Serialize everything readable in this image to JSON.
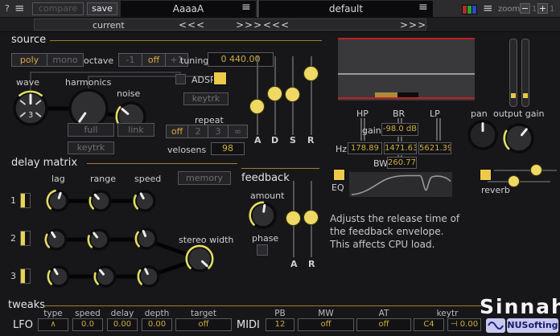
{
  "icons": {
    "menu": "≡"
  },
  "topbar": {
    "help": "?",
    "compare": "compare",
    "save": "save",
    "preset_current": "AaaaA",
    "preset_default": "default",
    "zoom_label": "zoom",
    "zoom_out": "−",
    "zoom_in": "+",
    "zoom_step": "1"
  },
  "nav": {
    "current": "current",
    "prev": "<<<",
    "next": ">>>"
  },
  "source": {
    "title": "source",
    "poly": "poly",
    "mono": "mono",
    "octave": "octave",
    "oct_down": "-1",
    "oct_off": "off",
    "oct_up": "+1",
    "tuning": "tuning",
    "tuning_value": "0 440.00",
    "wave": "wave",
    "wave_value": "3",
    "harmonics": "harmonics",
    "noise": "noise",
    "adsr": "ADSR",
    "keytrk": "keytrk",
    "full": "full",
    "link": "link",
    "repeat": "repeat",
    "repeat_off": "off",
    "repeat_2": "2",
    "repeat_3": "3",
    "repeat_inf": "∞",
    "velosens": "velosens",
    "velosens_value": "98",
    "env_a": "A",
    "env_d": "D",
    "env_s": "S",
    "env_r": "R"
  },
  "filter": {
    "hp": "HP",
    "br": "BR",
    "lp": "LP",
    "gain": "gain",
    "gain_value": "-98.0 dB",
    "hz": "Hz",
    "hp_freq": "178.89",
    "br_freq": "1471.63",
    "lp_freq": "5621.39",
    "bw": "BW",
    "bw_value": "260.77",
    "eq": "EQ"
  },
  "out": {
    "pan": "pan",
    "output_gain": "output gain",
    "reverb": "reverb"
  },
  "delay": {
    "title": "delay matrix",
    "lag": "lag",
    "range": "range",
    "speed": "speed",
    "memory": "memory",
    "row1": "1",
    "row2": "2",
    "row3": "3",
    "stereo_width": "stereo width"
  },
  "feedback": {
    "title": "feedback",
    "amount": "amount",
    "phase": "phase",
    "a": "A",
    "r": "R"
  },
  "tooltip": {
    "line1": "Adjusts the release time of",
    "line2": "the feedback envelope.",
    "line3": "This affects CPU load."
  },
  "tweaks": {
    "title": "tweaks",
    "lfo": "LFO",
    "midi": "MIDI",
    "col_type": "type",
    "col_speed": "speed",
    "col_delay": "delay",
    "col_depth": "depth",
    "col_target": "target",
    "col_pb": "PB",
    "col_mw": "MW",
    "col_at": "AT",
    "col_keytr": "keytr",
    "val_type": "∧",
    "val_speed": "0.0",
    "val_delay": "0.00",
    "val_depth": "0.00",
    "val_target": "off",
    "val_pb": "12",
    "val_mw": "off",
    "val_at": "off",
    "val_keytr_note": "C4",
    "val_keytr_amt": "⊣ 0.00"
  },
  "branding": {
    "title": "Sinnah",
    "company": "NUSofting"
  },
  "colors": {
    "accent_yellow": "#eec94a",
    "arc_yellow": "#e4dd62",
    "value_yellow": "#cfae3d",
    "underline_orange": "#a57c28",
    "red_line": "#c41e1e"
  }
}
